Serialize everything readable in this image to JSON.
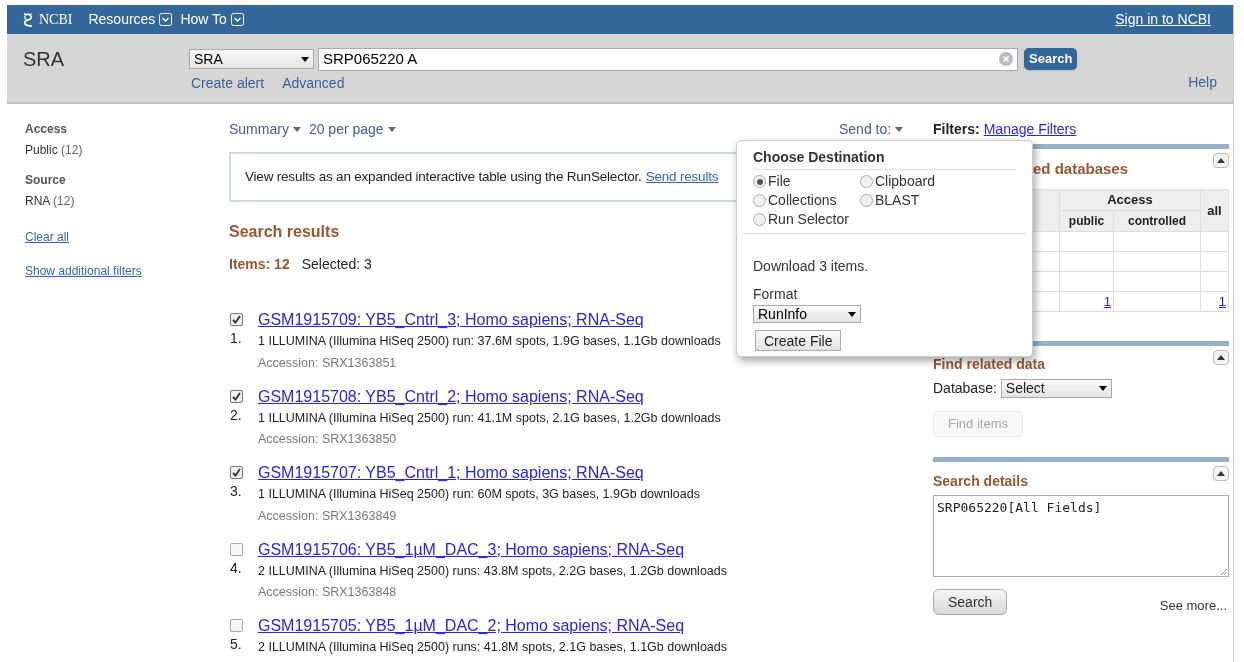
{
  "header": {
    "logo": "NCBI",
    "menus": [
      "Resources",
      "How To"
    ],
    "sign_in": "Sign in to NCBI"
  },
  "search_bar": {
    "database_name": "SRA",
    "db_select": "SRA",
    "query": "SRP065220 A",
    "search_button": "Search",
    "links": [
      "Create alert",
      "Advanced"
    ],
    "help": "Help"
  },
  "sidebar": {
    "groups": [
      {
        "title": "Access",
        "items": [
          {
            "label": "Public",
            "count": "(12)"
          }
        ]
      },
      {
        "title": "Source",
        "items": [
          {
            "label": "RNA",
            "count": "(12)"
          }
        ]
      }
    ],
    "links": [
      "Clear all",
      "Show additional filters"
    ]
  },
  "toolbar": {
    "display": [
      "Summary",
      "20 per page"
    ],
    "send_to": "Send to:",
    "filters_label": "Filters:",
    "manage_filters": "Manage Filters"
  },
  "banner": {
    "text": "View results as an expanded interactive table using the RunSelector.",
    "link": "Send results"
  },
  "results": {
    "title": "Search results",
    "items_count": "Items: 12",
    "selected_count": "Selected: 3",
    "items": [
      {
        "checked": true,
        "number": "1.",
        "title": "GSM1915709: YB5_Cntrl_3; Homo sapiens; RNA-Seq",
        "summary": "1 ILLUMINA (Illumina HiSeq 2500) run: 37.6M spots, 1.9G bases, 1.1Gb downloads",
        "accession": "Accession: SRX1363851"
      },
      {
        "checked": true,
        "number": "2.",
        "title": "GSM1915708: YB5_Cntrl_2; Homo sapiens; RNA-Seq",
        "summary": "1 ILLUMINA (Illumina HiSeq 2500) run: 41.1M spots, 2.1G bases, 1.2Gb downloads",
        "accession": "Accession: SRX1363850"
      },
      {
        "checked": true,
        "number": "3.",
        "title": "GSM1915707: YB5_Cntrl_1; Homo sapiens; RNA-Seq",
        "summary": "1 ILLUMINA (Illumina HiSeq 2500) run: 60M spots, 3G bases, 1.9Gb downloads",
        "accession": "Accession: SRX1363849"
      },
      {
        "checked": false,
        "number": "4.",
        "title": "GSM1915706: YB5_1µM_DAC_3; Homo sapiens; RNA-Seq",
        "summary": "2 ILLUMINA (Illumina HiSeq 2500) runs: 43.8M spots, 2.2G bases, 1.2Gb downloads",
        "accession": "Accession: SRX1363848"
      },
      {
        "checked": false,
        "number": "5.",
        "title": "GSM1915705: YB5_1µM_DAC_2; Homo sapiens; RNA-Seq",
        "summary": "2 ILLUMINA (Illumina HiSeq 2500) runs: 41.8M spots, 2.1G bases, 1.1Gb downloads"
      }
    ]
  },
  "send_to_popup": {
    "title": "Choose Destination",
    "destinations": [
      {
        "label": "File",
        "selected": true
      },
      {
        "label": "Clipboard",
        "selected": false
      },
      {
        "label": "Collections",
        "selected": false
      },
      {
        "label": "BLAST",
        "selected": false
      },
      {
        "label": "Run Selector",
        "selected": false
      }
    ],
    "message": "Download 3 items.",
    "format_label": "Format",
    "format": "RunInfo",
    "button": "Create File"
  },
  "related_databases": {
    "title": "ed databases",
    "group_header": "Access",
    "columns": [
      "public",
      "controlled"
    ],
    "all_header": "all",
    "rows": [
      {
        "kind": "empty"
      },
      {
        "kind": "empty"
      },
      {
        "kind": "empty"
      },
      {
        "kind": "counts",
        "public": "1",
        "all": "1"
      }
    ]
  },
  "find_related": {
    "title": "Find related data",
    "database_label": "Database:",
    "database_select": "Select",
    "button": "Find items",
    "button_disabled": true
  },
  "search_details": {
    "title": "Search details",
    "query": "SRP065220[All Fields]",
    "button": "Search",
    "see_more": "See more..."
  }
}
